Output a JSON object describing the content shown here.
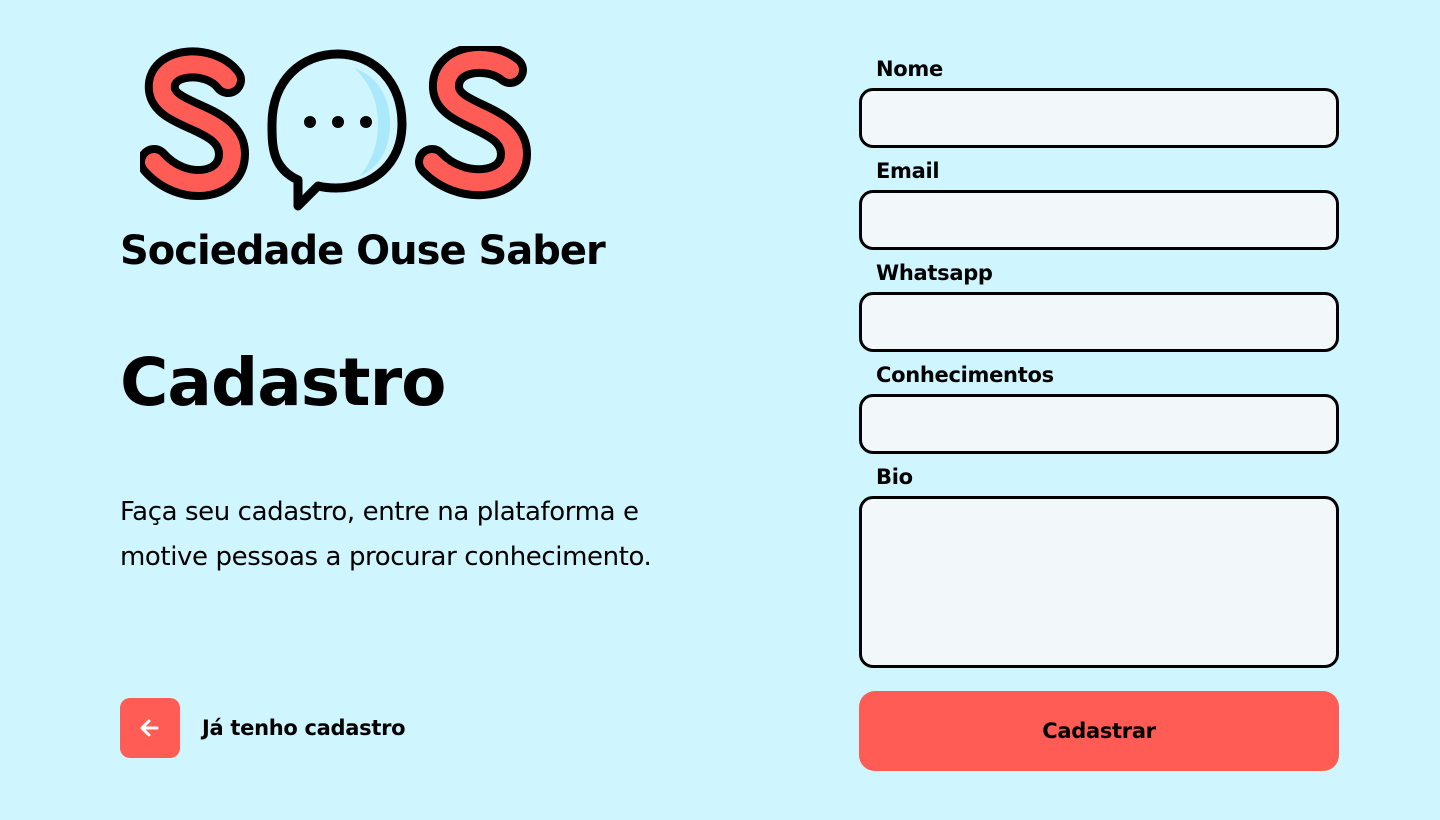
{
  "brand": {
    "logo_text": "SOS",
    "name": "Sociedade Ouse Saber",
    "accent_color": "#FF5C56",
    "background_color": "#CFF5FE"
  },
  "intro": {
    "title": "Cadastro",
    "description": "Faça seu cadastro, entre na plataforma e motive pessoas a procurar conhecimento."
  },
  "back_link": {
    "icon": "arrow-left-icon",
    "label": "Já tenho cadastro"
  },
  "form": {
    "fields": [
      {
        "label": "Nome",
        "value": "",
        "placeholder": ""
      },
      {
        "label": "Email",
        "value": "",
        "placeholder": ""
      },
      {
        "label": "Whatsapp",
        "value": "",
        "placeholder": ""
      },
      {
        "label": "Conhecimentos",
        "value": "",
        "placeholder": ""
      },
      {
        "label": "Bio",
        "value": "",
        "placeholder": ""
      }
    ],
    "submit_label": "Cadastrar"
  }
}
